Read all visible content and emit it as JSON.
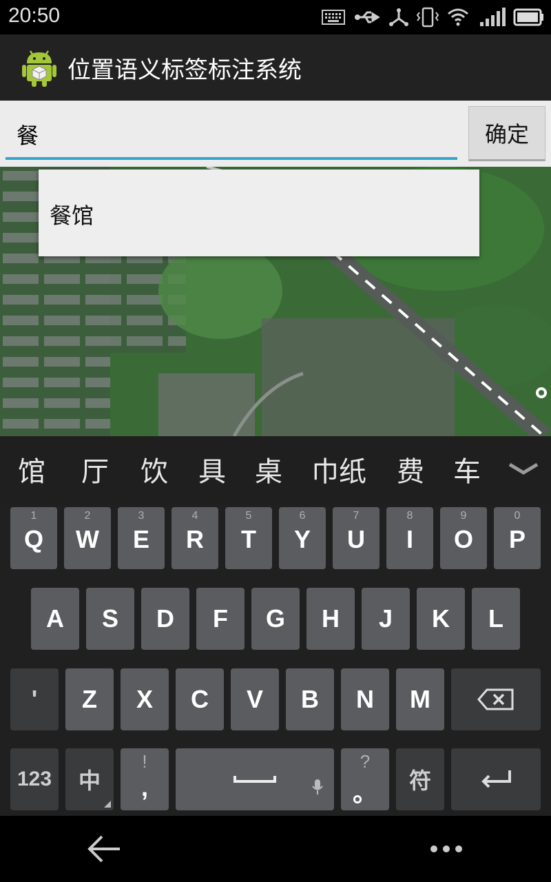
{
  "status_bar": {
    "time": "20:50",
    "icons": [
      "keyboard-icon",
      "usb-icon",
      "usb-debug-icon",
      "vibrate-icon",
      "wifi-icon",
      "signal-icon",
      "battery-icon"
    ]
  },
  "action_bar": {
    "title": "位置语义标签标注系统",
    "icon": "android-icon"
  },
  "search": {
    "value": "餐",
    "confirm_label": "确定"
  },
  "suggestions": [
    "餐馆"
  ],
  "keyboard": {
    "candidates": [
      "馆",
      "厅",
      "饮",
      "具",
      "桌",
      "巾纸",
      "费",
      "车"
    ],
    "row1": [
      {
        "num": "1",
        "letter": "Q"
      },
      {
        "num": "2",
        "letter": "W"
      },
      {
        "num": "3",
        "letter": "E"
      },
      {
        "num": "4",
        "letter": "R"
      },
      {
        "num": "5",
        "letter": "T"
      },
      {
        "num": "6",
        "letter": "Y"
      },
      {
        "num": "7",
        "letter": "U"
      },
      {
        "num": "8",
        "letter": "I"
      },
      {
        "num": "9",
        "letter": "O"
      },
      {
        "num": "0",
        "letter": "P"
      }
    ],
    "row2": [
      "A",
      "S",
      "D",
      "F",
      "G",
      "H",
      "J",
      "K",
      "L"
    ],
    "row3": [
      "'",
      "Z",
      "X",
      "C",
      "V",
      "B",
      "N",
      "M"
    ],
    "row4": {
      "numbers": "123",
      "lang": "中",
      "comma_alt": "!",
      "comma": ",",
      "period_alt": "?",
      "period": "。",
      "symbols": "符"
    }
  },
  "colors": {
    "accent": "#33a5c9",
    "key": "#5a5c5f",
    "key_dark": "#3a3b3d",
    "keyboard_bg": "#202020"
  }
}
